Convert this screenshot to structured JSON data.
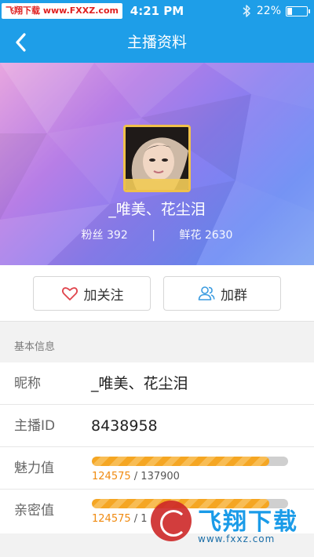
{
  "status_bar": {
    "watermark": "飞翔下载 www.FXXZ.com",
    "time": "4:21 PM",
    "battery": "22%",
    "battery_level": 0.22,
    "bluetooth_icon": "bluetooth-icon"
  },
  "nav": {
    "back_icon": "chevron-left-icon",
    "title": "主播资料"
  },
  "profile": {
    "avatar_icon": "avatar-photo",
    "name": "_唯美、花尘泪",
    "fans_label": "粉丝",
    "fans_count": "392",
    "separator": "|",
    "flowers_label": "鲜花",
    "flowers_count": "2630"
  },
  "actions": {
    "follow_icon": "heart-icon",
    "follow_label": "加关注",
    "group_icon": "group-users-icon",
    "group_label": "加群"
  },
  "info": {
    "section_title": "基本信息",
    "nickname_label": "昵称",
    "nickname_value": "_唯美、花尘泪",
    "id_label": "主播ID",
    "id_value": "8438958",
    "charm_label": "魅力值",
    "charm_current": "124575",
    "charm_total": "/ 137900",
    "charm_progress": 0.9034,
    "intimacy_label": "亲密值",
    "intimacy_current": "124575",
    "intimacy_total": "/ 1",
    "intimacy_progress": 0.9034
  },
  "watermark_logo": {
    "text": "飞翔下载",
    "url": "www.fxxz.com"
  },
  "colors": {
    "primary": "#1e9ee8",
    "accent_orange": "#f5a623",
    "follow_heart": "#e0454d",
    "group_icon": "#3a9be0"
  }
}
